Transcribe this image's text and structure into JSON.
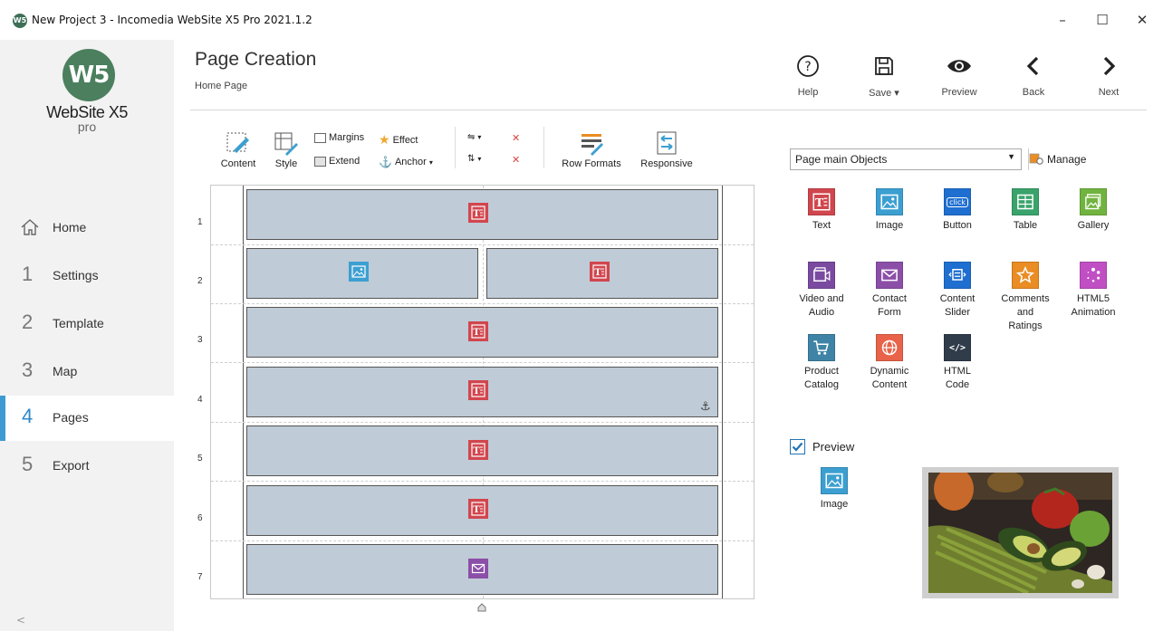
{
  "window": {
    "title": "New Project 3 - Incomedia WebSite X5 Pro 2021.1.2",
    "app_icon": "W5",
    "minimize": "–",
    "maximize": "☐",
    "close": "✕"
  },
  "logo": {
    "mark": "W5",
    "name": "WebSite X5",
    "edition": "pro"
  },
  "nav": {
    "items": [
      {
        "num": "",
        "label": "Home",
        "icon": "home-icon"
      },
      {
        "num": "1",
        "label": "Settings"
      },
      {
        "num": "2",
        "label": "Template"
      },
      {
        "num": "3",
        "label": "Map"
      },
      {
        "num": "4",
        "label": "Pages",
        "active": true
      },
      {
        "num": "5",
        "label": "Export"
      }
    ],
    "scroll_arrow": "<"
  },
  "header": {
    "title": "Page Creation",
    "subtitle": "Home Page",
    "buttons": {
      "help": "Help",
      "save": "Save ▾",
      "preview": "Preview",
      "back": "Back",
      "next": "Next"
    }
  },
  "toolbar": {
    "content": "Content",
    "style": "Style",
    "margins": "Margins",
    "extend": "Extend",
    "effect": "Effect",
    "anchor": "Anchor",
    "row_formats": "Row Formats",
    "responsive": "Responsive"
  },
  "grid": {
    "rows": [
      "1",
      "2",
      "3",
      "4",
      "5",
      "6",
      "7"
    ],
    "anchor_glyph": "⚓"
  },
  "objects_panel": {
    "category": "Page main Objects",
    "manage": "Manage",
    "items": [
      {
        "label": "Text",
        "icon": "text-object-icon",
        "color": "#d1464e"
      },
      {
        "label": "Image",
        "icon": "image-object-icon",
        "color": "#3c9fd1"
      },
      {
        "label": "Button",
        "icon": "button-object-icon",
        "color": "#1f6fd0",
        "glyph": "click"
      },
      {
        "label": "Table",
        "icon": "table-object-icon",
        "color": "#3aa36c"
      },
      {
        "label": "Gallery",
        "icon": "gallery-object-icon",
        "color": "#71b33f"
      },
      {
        "label": "Video and\nAudio",
        "icon": "video-audio-object-icon",
        "color": "#7a4aa0"
      },
      {
        "label": "Contact\nForm",
        "icon": "contact-form-object-icon",
        "color": "#8c4fa8"
      },
      {
        "label": "Content\nSlider",
        "icon": "content-slider-object-icon",
        "color": "#1f6fd0"
      },
      {
        "label": "Comments\nand\nRatings",
        "icon": "comments-ratings-object-icon",
        "color": "#e98d24"
      },
      {
        "label": "HTML5\nAnimation",
        "icon": "html5-animation-object-icon",
        "color": "#c04fc4"
      },
      {
        "label": "Product\nCatalog",
        "icon": "product-catalog-object-icon",
        "color": "#3f84a6"
      },
      {
        "label": "Dynamic\nContent",
        "icon": "dynamic-content-object-icon",
        "color": "#e8634a"
      },
      {
        "label": "HTML\nCode",
        "icon": "html-code-object-icon",
        "color": "#303c4a",
        "glyph": "</>"
      }
    ]
  },
  "preview": {
    "label": "Preview",
    "checked": true,
    "selected_label": "Image"
  },
  "colors": {
    "accent": "#3d9bd1",
    "cell": "#bfcbd6",
    "sidebar": "#f2f2f2"
  }
}
